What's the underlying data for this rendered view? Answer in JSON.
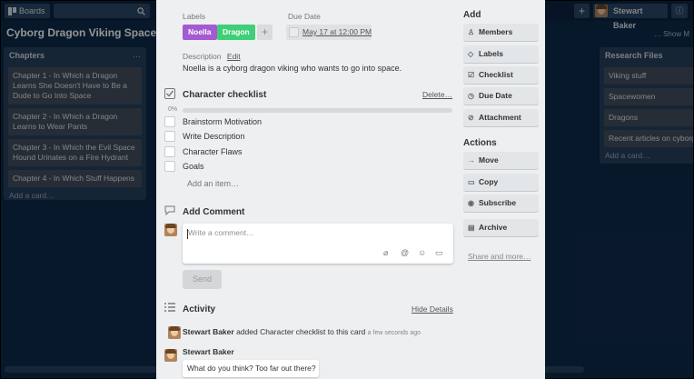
{
  "topbar": {
    "boards_label": "Boards",
    "user_name": "Stewart Baker"
  },
  "board": {
    "title": "Cyborg Dragon Viking Spacewom",
    "show_menu": "… Show M"
  },
  "lists": [
    {
      "title": "Chapters",
      "cards": [
        "Chapter 1 - In Which a Dragon Learns She Doesn't Have to Be a Dude to Go Into Space",
        "Chapter 2 - In Which a Dragon Learns to Wear Pants",
        "Chapter 3 - In Which the Evil Space Hound Urinates on a Fire Hydrant",
        "Chapter 4 - In Which Stuff Happens"
      ],
      "add_card": "Add a card…"
    },
    {
      "title": "Research Files",
      "cards": [
        "Viking stuff",
        "Spacewomen",
        "Dragons",
        "Recent articles on cyborg"
      ],
      "add_card": "Add a card…"
    }
  ],
  "card": {
    "labels_heading": "Labels",
    "labels": [
      {
        "text": "Noella",
        "color": "#a45ad1"
      },
      {
        "text": "Dragon",
        "color": "#3fcf77"
      }
    ],
    "add_label_symbol": "+",
    "due_heading": "Due Date",
    "due_value": "May 17 at 12:00 PM",
    "description_heading": "Description",
    "description_edit": "Edit",
    "description": "Noella is a cyborg dragon viking who wants to go into space.",
    "checklist": {
      "title": "Character checklist",
      "delete_label": "Delete…",
      "progress_text": "0%",
      "progress": 0,
      "items": [
        "Brainstorm Motivation",
        "Write Description",
        "Character Flaws",
        "Goals"
      ],
      "add_item": "Add an item…"
    },
    "comment": {
      "heading": "Add Comment",
      "placeholder": "Write a comment…",
      "send_label": "Send"
    },
    "activity": {
      "heading": "Activity",
      "hide_details": "Hide Details",
      "entry_user": "Stewart Baker",
      "entry_text": "added Character checklist to this card",
      "entry_time": "a few seconds ago",
      "comment_user": "Stewart Baker",
      "comment_text": "What do you think? Too far out there?"
    }
  },
  "sidebar": {
    "add_heading": "Add",
    "add_buttons": [
      "Members",
      "Labels",
      "Checklist",
      "Due Date",
      "Attachment"
    ],
    "actions_heading": "Actions",
    "action_buttons": [
      "Move",
      "Copy",
      "Subscribe",
      "Archive"
    ],
    "share_link": "Share and more…"
  }
}
